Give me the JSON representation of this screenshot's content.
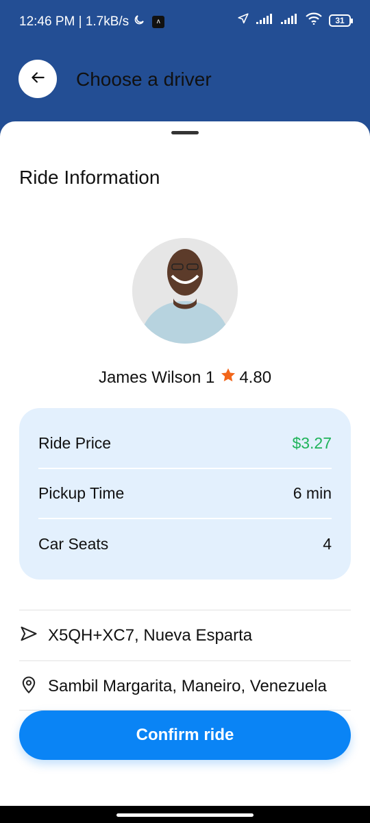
{
  "status_bar": {
    "time_speed": "12:46 PM | 1.7kB/s",
    "battery": "31"
  },
  "header": {
    "title": "Choose a driver"
  },
  "sheet": {
    "section_title": "Ride Information",
    "driver": {
      "name": "James Wilson 1",
      "rating": "4.80"
    },
    "details": [
      {
        "label": "Ride Price",
        "value": "$3.27"
      },
      {
        "label": "Pickup Time",
        "value": "6 min"
      },
      {
        "label": "Car Seats",
        "value": "4"
      }
    ],
    "origin": "X5QH+XC7, Nueva Esparta",
    "destination": "Sambil Margarita, Maneiro, Venezuela",
    "confirm_label": "Confirm ride"
  },
  "colors": {
    "header_bg": "#234e94",
    "price_green": "#1fb35a",
    "accent_blue": "#0a84f5",
    "card_bg": "#e3f0fd",
    "star_orange": "#f2661a"
  }
}
